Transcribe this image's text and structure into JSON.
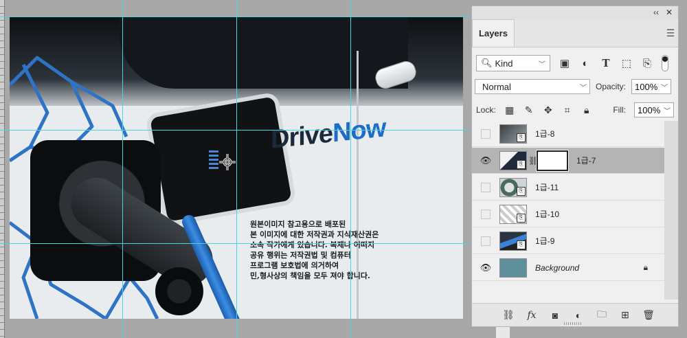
{
  "canvas": {
    "brand_part1": "Drive",
    "brand_part2": "Now",
    "watermark_lines": [
      "원본이미지 참고용으로 배포된",
      "본 이미지에 대한 저작권과 지식재산권은",
      "소속 작가에게 있습니다. 복제나 어떠지",
      "공유 행위는 저작권법 및 컴퓨터",
      "프로그램 보호법에 의거하여",
      "민,형사상의 책임을 모두 져야 합니다."
    ]
  },
  "panel": {
    "collapse_label": "‹‹",
    "close_label": "✕",
    "tab_label": "Layers",
    "menu_icon": "panel-menu-icon",
    "filter": {
      "kind_label": "Kind",
      "icons": [
        "pixel-filter-icon",
        "adjustment-filter-icon",
        "type-filter-icon",
        "shape-filter-icon",
        "smart-object-filter-icon"
      ]
    },
    "blend_mode": "Normal",
    "opacity_label": "Opacity:",
    "opacity_value": "100%",
    "lock_label": "Lock:",
    "fill_label": "Fill:",
    "fill_value": "100%",
    "lock_icons": [
      "lock-transparent-icon",
      "lock-pixels-icon",
      "lock-position-icon",
      "lock-artboard-icon",
      "lock-all-icon"
    ],
    "layers": [
      {
        "name": "1급-8",
        "visible": false,
        "selected": false,
        "mask": false
      },
      {
        "name": "1급-7",
        "visible": true,
        "selected": true,
        "mask": true
      },
      {
        "name": "1급-11",
        "visible": false,
        "selected": false,
        "mask": false
      },
      {
        "name": "1급-10",
        "visible": false,
        "selected": false,
        "mask": false
      },
      {
        "name": "1급-9",
        "visible": false,
        "selected": false,
        "mask": false
      },
      {
        "name": "Background",
        "visible": true,
        "selected": false,
        "mask": false,
        "locked": true
      }
    ],
    "footer_icons": [
      "link-layers-icon",
      "fx-icon",
      "add-mask-icon",
      "adjustment-layer-icon",
      "new-group-icon",
      "new-layer-icon",
      "delete-layer-icon"
    ],
    "footer_fx_label": "fx"
  },
  "colors": {
    "guide": "#44d7e0",
    "brand_blue": "#1d6cc7",
    "background_swatch": "#5e8f9a",
    "selected_row": "#b4b4b4"
  }
}
